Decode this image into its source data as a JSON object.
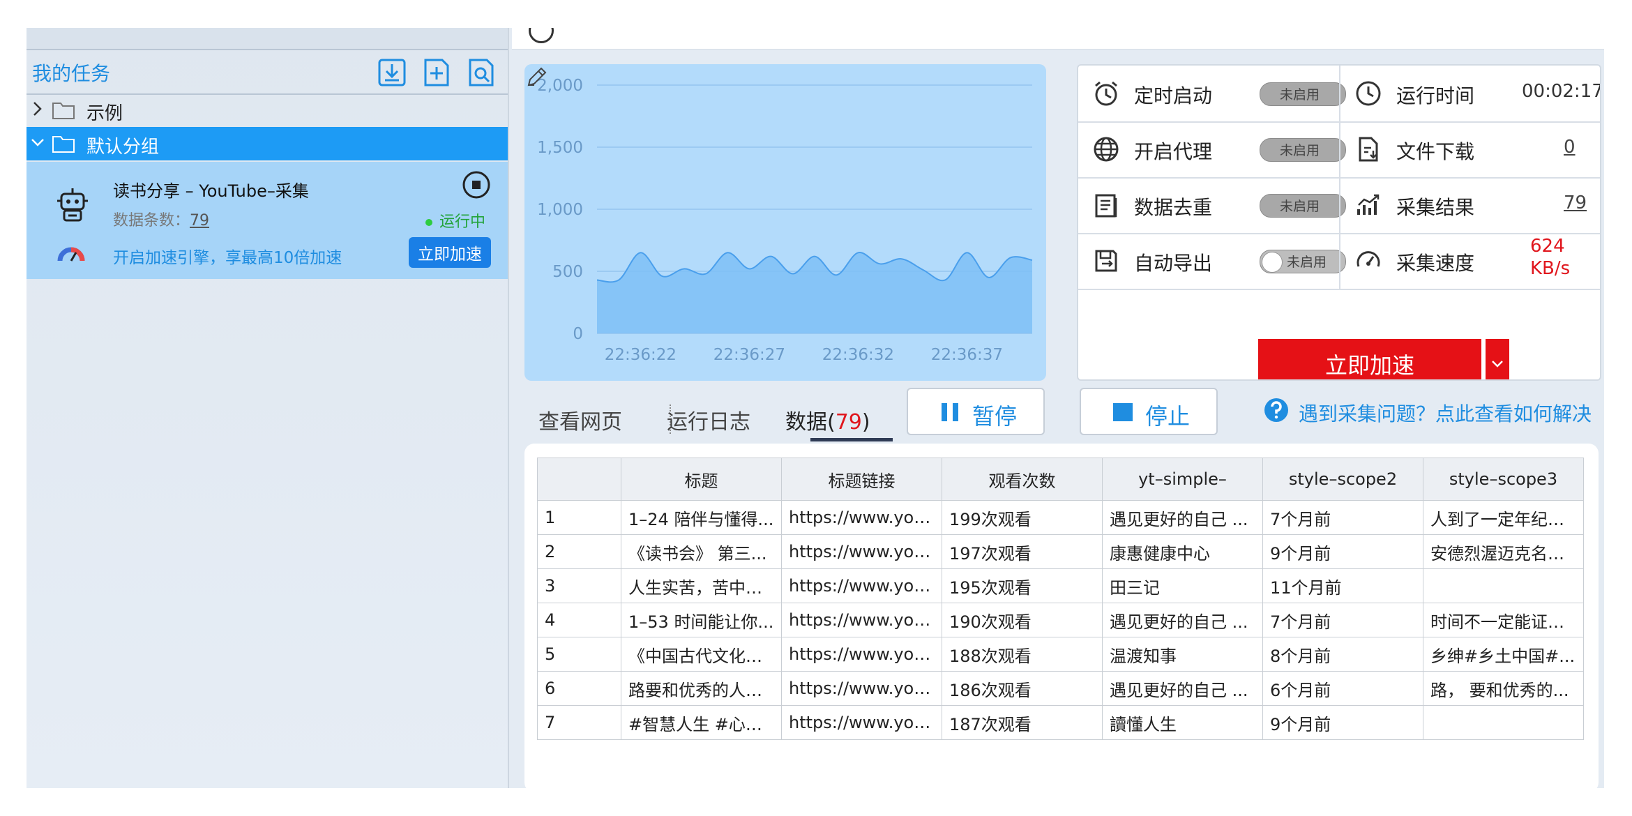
{
  "sidebar": {
    "title": "我的任务",
    "tree": {
      "example": "示例",
      "default_group": "默认分组"
    },
    "task": {
      "name": "读书分享 – YouTube–采集",
      "data_count_label": "数据条数：",
      "data_count": "79",
      "status": "运行中",
      "accel_text": "开启加速引擎，享最高10倍加速",
      "accel_button": "立即加速"
    }
  },
  "settings": {
    "timed_start": "定时启动",
    "proxy": "开启代理",
    "dedupe": "数据去重",
    "auto_export": "自动导出",
    "toggle_off": "未启用",
    "run_time_label": "运行时间",
    "run_time": "00:02:17",
    "file_download_label": "文件下载",
    "file_download": "0",
    "result_label": "采集结果",
    "result": "79",
    "speed_label": "采集速度",
    "speed_value": "624",
    "speed_unit": "KB/s",
    "speed_button": "立即加速"
  },
  "tabs": {
    "webpage": "查看网页",
    "log": "运行日志",
    "data": "数据(",
    "data_count": "79",
    "data_close": ")"
  },
  "controls": {
    "pause": "暂停",
    "stop": "停止"
  },
  "help": {
    "text": "遇到采集问题？点此查看如何解决"
  },
  "chart_data": {
    "type": "area",
    "x": [
      "22:36:20",
      "22:36:21",
      "22:36:22",
      "22:36:23",
      "22:36:24",
      "22:36:25",
      "22:36:26",
      "22:36:27",
      "22:36:28",
      "22:36:29",
      "22:36:30",
      "22:36:31",
      "22:36:32",
      "22:36:33",
      "22:36:34",
      "22:36:35",
      "22:36:36",
      "22:36:37",
      "22:36:38",
      "22:36:39",
      "22:36:40"
    ],
    "values": [
      430,
      430,
      650,
      460,
      520,
      480,
      650,
      520,
      620,
      480,
      620,
      470,
      650,
      560,
      600,
      510,
      430,
      650,
      450,
      610,
      590
    ],
    "x_ticks": [
      "22:36:22",
      "22:36:27",
      "22:36:32",
      "22:36:37"
    ],
    "y_ticks": [
      "2,000",
      "1,500",
      "1,000",
      "500",
      "0"
    ],
    "ylim": [
      0,
      2000
    ],
    "colors": {
      "fill": "#7ebff6",
      "line": "#4a9fec",
      "grid": "#9ccaf2"
    }
  },
  "table": {
    "headers": [
      "",
      "标题",
      "标题链接",
      "观看次数",
      "yt–simple–",
      "style–scope2",
      "style–scope3"
    ],
    "rows": [
      [
        "1",
        "1–24 陪伴与懂得...",
        "https://www.you...",
        "199次观看",
        "遇见更好的自己 ...",
        "7个月前",
        "人到了一定年纪，..."
      ],
      [
        "2",
        "《读书会》 第三...",
        "https://www.you...",
        "197次观看",
        "康惠健康中心",
        "9个月前",
        "安德烈渥迈克名著..."
      ],
      [
        "3",
        "人生实苦，苦中作...",
        "https://www.you...",
        "195次观看",
        "田三记",
        "11个月前",
        ""
      ],
      [
        "4",
        "1–53 时间能让你...",
        "https://www.you...",
        "190次观看",
        "遇见更好的自己 ...",
        "7个月前",
        "时间不一定能证明..."
      ],
      [
        "5",
        "《中国古代文化常...",
        "https://www.you...",
        "188次观看",
        "温渡知事",
        "8个月前",
        "乡绅#乡土中国#..."
      ],
      [
        "6",
        "路要和优秀的人一...",
        "https://www.you...",
        "186次观看",
        "遇见更好的自己 ...",
        "6个月前",
        "路， 要和优秀的..."
      ],
      [
        "7",
        "#智慧人生 #心计...",
        "https://www.you...",
        "187次观看",
        "讀懂人生",
        "9个月前",
        ""
      ]
    ]
  }
}
